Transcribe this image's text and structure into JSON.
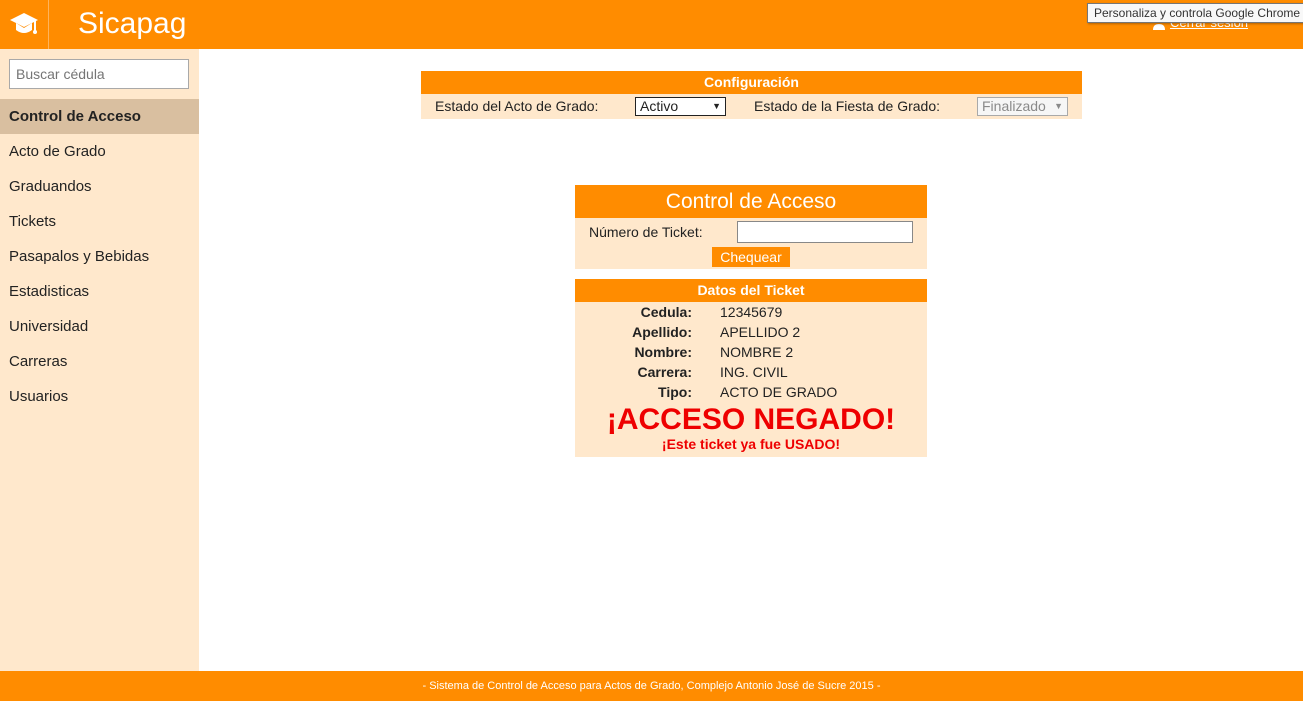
{
  "header": {
    "app_title": "Sicapag",
    "logout_label": "Cerrar sesión",
    "logo_icon": "graduation-cap-icon",
    "user_icon": "user-icon"
  },
  "browser_tooltip": "Personaliza y controla Google Chrome",
  "sidebar": {
    "search_placeholder": "Buscar cédula",
    "items": [
      {
        "label": "Control de Acceso",
        "active": true
      },
      {
        "label": "Acto de Grado",
        "active": false
      },
      {
        "label": "Graduandos",
        "active": false
      },
      {
        "label": "Tickets",
        "active": false
      },
      {
        "label": "Pasapalos y Bebidas",
        "active": false
      },
      {
        "label": "Estadisticas",
        "active": false
      },
      {
        "label": "Universidad",
        "active": false
      },
      {
        "label": "Carreras",
        "active": false
      },
      {
        "label": "Usuarios",
        "active": false
      }
    ]
  },
  "config": {
    "title": "Configuración",
    "acto_label": "Estado del Acto de Grado:",
    "acto_value": "Activo",
    "fiesta_label": "Estado de la Fiesta de Grado:",
    "fiesta_value": "Finalizado"
  },
  "access": {
    "title": "Control de Acceso",
    "ticket_label": "Número de Ticket:",
    "ticket_value": "",
    "check_button": "Chequear"
  },
  "ticket": {
    "title": "Datos del Ticket",
    "rows": [
      {
        "key": "Cedula:",
        "value": "12345679"
      },
      {
        "key": "Apellido:",
        "value": "APELLIDO 2"
      },
      {
        "key": "Nombre:",
        "value": "NOMBRE 2"
      },
      {
        "key": "Carrera:",
        "value": "ING. CIVIL"
      },
      {
        "key": "Tipo:",
        "value": "ACTO DE GRADO"
      }
    ],
    "status": "¡ACCESO NEGADO!",
    "status_detail": "¡Este ticket ya fue USADO!"
  },
  "footer": {
    "text": "- Sistema de Control de Acceso para Actos de Grado, Complejo Antonio José de Sucre 2015 -"
  },
  "colors": {
    "brand": "#ff8c00",
    "panel": "#ffe8cc",
    "active_nav": "#d9bfa0",
    "denied": "#ee0000"
  }
}
